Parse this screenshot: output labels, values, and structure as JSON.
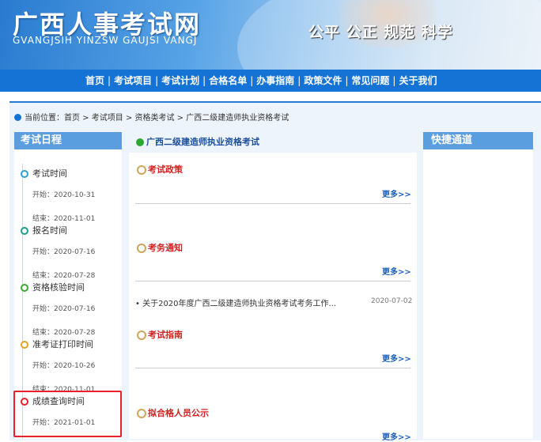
{
  "header": {
    "site_title": "广西人事考试网",
    "site_subtitle": "GVANGJSIH YINZSW GAUJSI VANGJ",
    "slogan": "公平 公正 规范 科学"
  },
  "nav": {
    "items": [
      "首页",
      "考试项目",
      "考试计划",
      "合格名单",
      "办事指南",
      "政策文件",
      "常见问题",
      "关于我们"
    ]
  },
  "breadcrumb": {
    "label": "当前位置：",
    "path": "首页 > 考试项目 > 资格类考试 > 广西二级建造师执业资格考试"
  },
  "schedule": {
    "title": "考试日程",
    "items": [
      {
        "name": "考试时间",
        "start": "开始：2020-10-31",
        "end": "结束：2020-11-01",
        "color": "#2aa0d8"
      },
      {
        "name": "报名时间",
        "start": "开始：2020-07-16",
        "end": "结束：2020-07-28",
        "color": "#1aa08a"
      },
      {
        "name": "资格核验时间",
        "start": "开始：2020-07-16",
        "end": "结束：2020-07-28",
        "color": "#3aa832"
      },
      {
        "name": "准考证打印时间",
        "start": "开始：2020-10-26",
        "end": "结束：2020-11-01",
        "color": "#e8a020"
      },
      {
        "name": "成绩查询时间",
        "start": "开始：2021-01-01",
        "end": "",
        "color": "#e8202a"
      }
    ]
  },
  "main": {
    "title": "广西二级建造师执业资格考试",
    "more_label": "更多>>",
    "sections": [
      {
        "title": "考试政策"
      },
      {
        "title": "考务通知"
      },
      {
        "title": "考试指南"
      },
      {
        "title": "拟合格人员公示"
      }
    ],
    "news": [
      {
        "title": "• 关于2020年度广西二级建造师执业资格考试考务工作...",
        "date": "2020-07-02"
      }
    ]
  },
  "quick": {
    "title": "快捷通道"
  }
}
